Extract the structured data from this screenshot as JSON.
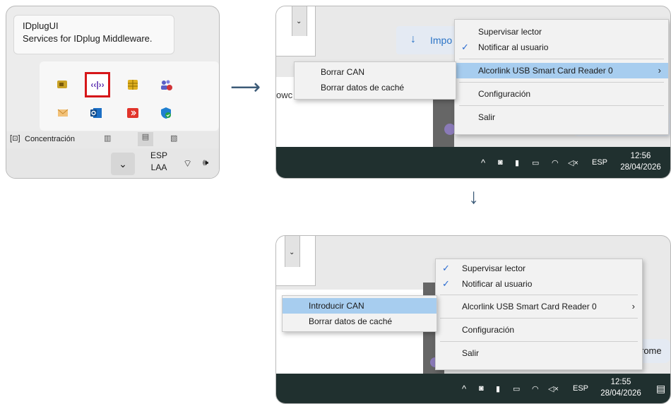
{
  "panel1": {
    "tooltip": {
      "title": "IDplugUI",
      "subtitle": "Services for IDplug Middleware."
    },
    "tray_icons_row1": [
      "smartcard-icon",
      "idplug-icon",
      "chip-icon",
      "teams-icon"
    ],
    "tray_icons_row2": [
      "mail-icon",
      "outlook-icon",
      "remote-icon",
      "defender-icon"
    ],
    "taskbar_items": {
      "focus_label": "Concentración"
    },
    "language": {
      "lang": "ESP",
      "region": "LAA"
    },
    "colors": {
      "highlight_border": "#d6171a"
    }
  },
  "panel2": {
    "import_label": "Impo",
    "bg_text_left": "owc",
    "menu": [
      {
        "label": "Supervisar lector",
        "checked": false
      },
      {
        "label": "Notificar al usuario",
        "checked": true
      },
      {
        "label": "Alcorlink USB Smart Card Reader 0",
        "highlighted": true,
        "submenu": true
      },
      {
        "label": "Configuración"
      },
      {
        "label": "Salir"
      }
    ],
    "submenu": [
      {
        "label": "Borrar CAN"
      },
      {
        "label": "Borrar datos de caché"
      }
    ],
    "taskbar": {
      "lang": "ESP",
      "time": "12:56",
      "date": "28/04/2026"
    }
  },
  "panel3": {
    "bg_text_right": "rome",
    "menu": [
      {
        "label": "Supervisar lector",
        "checked": true
      },
      {
        "label": "Notificar al usuario",
        "checked": true
      },
      {
        "label": "Alcorlink USB Smart Card Reader 0",
        "submenu": true
      },
      {
        "label": "Configuración"
      },
      {
        "label": "Salir"
      }
    ],
    "submenu": [
      {
        "label": "Introducir CAN",
        "highlighted": true
      },
      {
        "label": "Borrar datos de caché"
      }
    ],
    "taskbar": {
      "lang": "ESP",
      "time": "12:55",
      "date": "28/04/2026"
    }
  },
  "flow": {
    "right_arrow": "⟶",
    "down_arrow": "↓"
  },
  "colors": {
    "menu_highlight": "#a7cdef",
    "taskbar": "#20302f",
    "check": "#2a6bd0",
    "arrow": "#3c5b78"
  }
}
